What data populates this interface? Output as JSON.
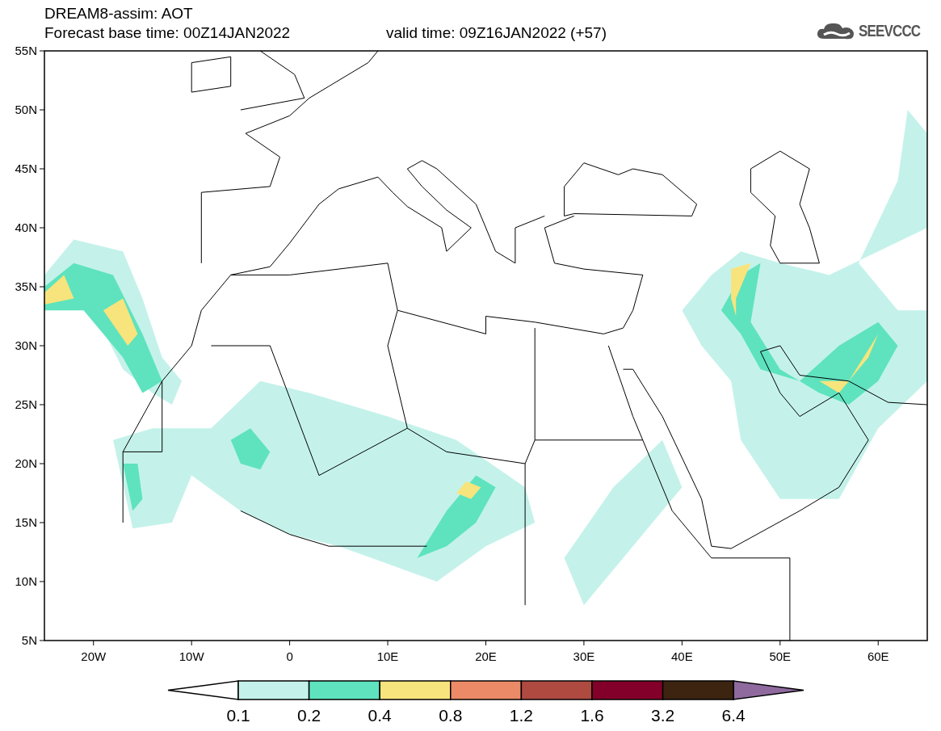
{
  "header": {
    "title": "DREAM8-assim: AOT",
    "base_time": "Forecast base time: 00Z14JAN2022",
    "valid_time": "valid time: 09Z16JAN2022 (+57)",
    "logo_text": "SEEVCCC"
  },
  "map": {
    "lat_labels": [
      "55N",
      "50N",
      "45N",
      "40N",
      "35N",
      "30N",
      "25N",
      "20N",
      "15N",
      "10N",
      "5N"
    ],
    "lon_labels": [
      "20W",
      "10W",
      "0",
      "10E",
      "20E",
      "30E",
      "40E",
      "50E",
      "60E"
    ]
  },
  "colorbar": {
    "swatches": [
      {
        "color": "#ffffff"
      },
      {
        "color": "#c4f2ea"
      },
      {
        "color": "#5ee3be"
      },
      {
        "color": "#f8e47c"
      },
      {
        "color": "#ec8a68"
      },
      {
        "color": "#ae4a40"
      },
      {
        "color": "#82002a"
      },
      {
        "color": "#3c2410"
      },
      {
        "color": "#8e6a9e"
      }
    ],
    "labels": [
      "0.1",
      "0.2",
      "0.4",
      "0.8",
      "1.2",
      "1.6",
      "3.2",
      "6.4"
    ]
  }
}
